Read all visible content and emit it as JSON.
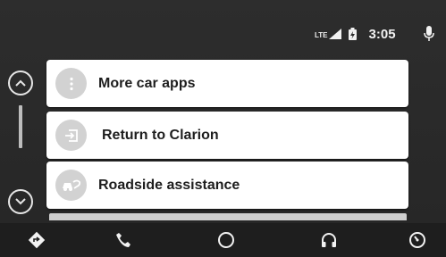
{
  "status_bar": {
    "network": "LTE",
    "time": "3:05",
    "icons": [
      "signal-icon",
      "battery-icon",
      "microphone-icon"
    ]
  },
  "scroll": {
    "icons": [
      "chevron-up-icon",
      "chevron-down-icon"
    ]
  },
  "list": {
    "items": [
      {
        "label": "More car apps",
        "icon": "more-vert-icon"
      },
      {
        "label": "Return to Clarion",
        "icon": "exit-app-icon"
      },
      {
        "label": "Roadside assistance",
        "icon": "roadside-car-icon"
      }
    ]
  },
  "navbar": {
    "items": [
      {
        "icon": "navigation-icon"
      },
      {
        "icon": "phone-icon"
      },
      {
        "icon": "home-icon"
      },
      {
        "icon": "headphones-icon"
      },
      {
        "icon": "car-menu-icon"
      }
    ]
  },
  "colors": {
    "background": "#2a2a2a",
    "card": "#ffffff",
    "icon_circle": "#d2d2d2",
    "text": "#1e1e1e",
    "navbar": "#1e1e1e"
  }
}
